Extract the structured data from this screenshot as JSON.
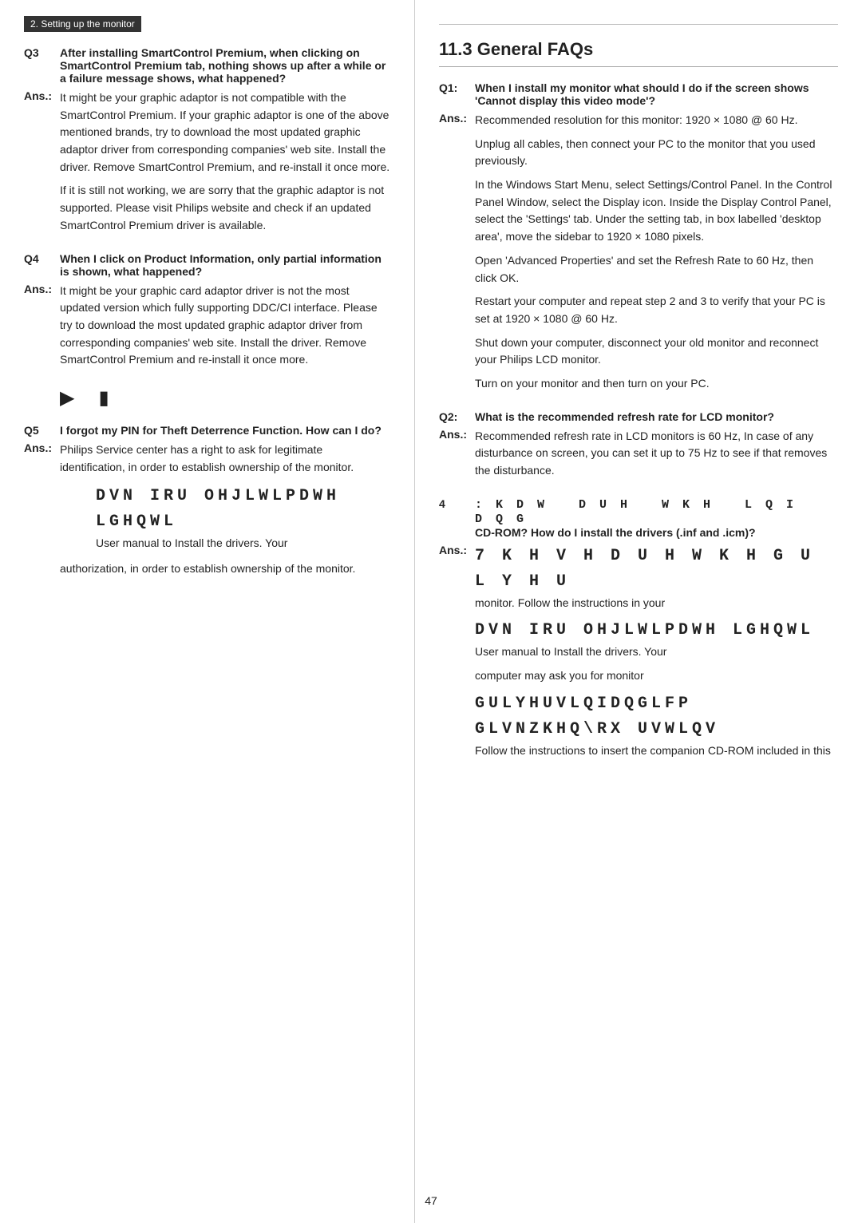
{
  "header": {
    "section_label": "2. Setting up the monitor"
  },
  "left": {
    "questions": [
      {
        "id": "Q3",
        "question": "After installing SmartControl Premium, when clicking on SmartControl Premium tab, nothing shows up after a while or a failure message shows, what happened?",
        "answer_paragraphs": [
          "It might be your graphic adaptor is not compatible with the SmartControl Premium. If your graphic adaptor is one of the above mentioned brands, try to download the most updated graphic adaptor driver from corresponding companies' web site. Install the driver. Remove SmartControl Premium, and re-install it once more.",
          "If it is still not working, we are sorry that the graphic adaptor is not supported. Please visit Philips website and check if an updated SmartControl Premium driver is available."
        ]
      },
      {
        "id": "Q4",
        "question": "When I click on Product Information, only partial information is shown, what happened?",
        "answer_paragraphs": [
          "It might be your graphic card adaptor driver is not the most updated version which fully supporting DDC/CI interface. Please try to download the most updated graphic adaptor driver from corresponding companies' web site. Install the driver. Remove SmartControl Premium and re-install it once more."
        ]
      },
      {
        "id": "Q5",
        "question": "I forgot my PIN for Theft Deterrence Function. How can I do?",
        "answer_paragraphs": [
          "Philips Service center has a right to ask for legitimate identification, in order to establish ownership of the monitor."
        ]
      }
    ],
    "icon_placeholder_1": "▶",
    "icon_placeholder_2": "▮",
    "corruption_q5_line1": "DVN IRU OHJLWLPDWH LGHQWL",
    "corruption_q5_line2": "User manual to Install the drivers. Your",
    "page_number": "47"
  },
  "right": {
    "section_title": "11.3 General FAQs",
    "questions": [
      {
        "id": "Q1:",
        "question": "When I install my monitor what should I do if the screen shows 'Cannot display this video mode'?",
        "answer_paragraphs": [
          "Recommended resolution for this monitor: 1920 × 1080 @ 60 Hz.",
          "Unplug all cables, then connect your PC to the monitor that you used previously.",
          "In the Windows Start Menu, select Settings/Control Panel. In the Control Panel Window, select the Display icon. Inside the Display Control Panel, select the 'Settings' tab. Under the setting tab, in box labelled 'desktop area', move the sidebar to 1920 × 1080 pixels.",
          "Open 'Advanced Properties' and set the Refresh Rate to 60 Hz, then click OK.",
          "Restart your computer and repeat step 2 and 3 to verify that your PC is set at 1920 × 1080 @ 60 Hz.",
          "Shut down your computer, disconnect your old monitor and reconnect your Philips LCD monitor.",
          "Turn on your monitor and then turn on your PC."
        ]
      },
      {
        "id": "Q2:",
        "question": "What is the recommended refresh rate for LCD monitor?",
        "answer_paragraphs": [
          "Recommended refresh rate in LCD monitors is 60 Hz, In case of any disturbance on screen, you can set it up to 75 Hz to see if that removes the disturbance."
        ]
      },
      {
        "id": "Q3_right",
        "id_display": "4",
        "question": ": K D W   D U H   W K H   L Q I   D Q G CD-ROM? How do I install the drivers (.inf and .icm)?",
        "answer_prefix": "Ans.:",
        "answer_corruption_1": "7 K H V H   D U H   W K H   G U L Y H U",
        "answer_text_1": "monitor. Follow the instructions in your",
        "answer_corruption_2": "DVN IRU OHJLWLPDWH LGHQWL",
        "answer_text_2": "User manual to Install the drivers. Your",
        "answer_text_3": "computer may ask you for monitor",
        "answer_corruption_3": "GULYHUVLQIDQGLFP",
        "answer_corruption_4": "GLVNZKHQ\\RX  UVWLQV",
        "answer_text_4": "Follow the instructions to insert the companion CD-ROM included in this"
      }
    ]
  }
}
